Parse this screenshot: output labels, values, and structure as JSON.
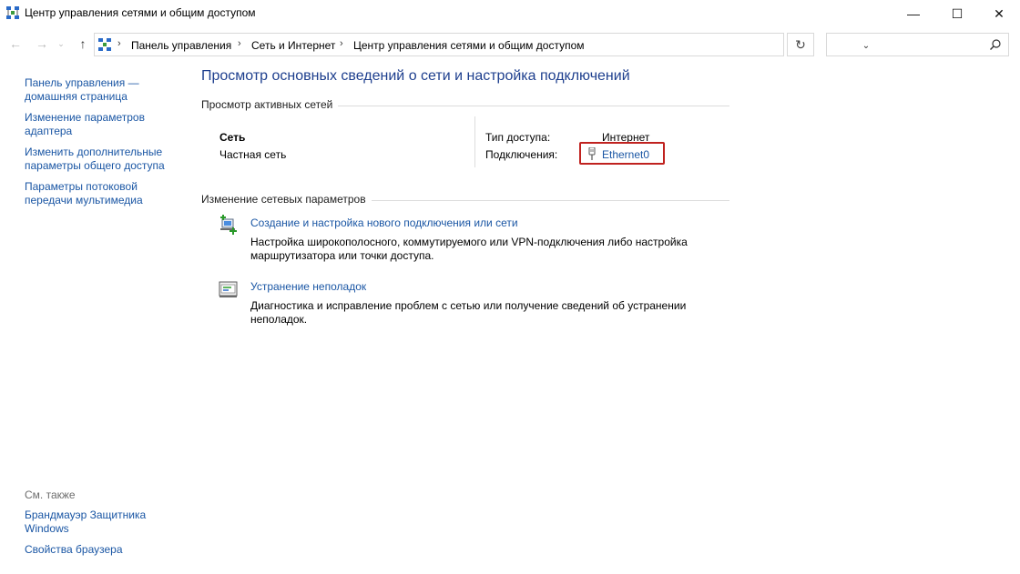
{
  "window": {
    "title": "Центр управления сетями и общим доступом",
    "minimize_glyph": "—",
    "maximize_glyph": "☐",
    "close_glyph": "✕"
  },
  "nav": {
    "back_glyph": "←",
    "forward_glyph": "→",
    "recent_glyph": "⌄",
    "up_glyph": "↑",
    "refresh_glyph": "↻",
    "dropdown_glyph": "⌄"
  },
  "breadcrumb": {
    "items": [
      "Панель управления",
      "Сеть и Интернет",
      "Центр управления сетями и общим доступом"
    ],
    "separator": "›"
  },
  "search": {
    "value": "",
    "placeholder": ""
  },
  "sidebar": {
    "links": [
      [
        "Панель управления —",
        "домашняя страница"
      ],
      [
        "Изменение параметров",
        "адаптера"
      ],
      [
        "Изменить дополнительные",
        "параметры общего доступа"
      ],
      [
        "Параметры потоковой",
        "передачи мультимедиа"
      ]
    ],
    "see_also_label": "См. также",
    "see_also_links": [
      [
        "Брандмауэр Защитника",
        "Windows"
      ],
      [
        "Свойства браузера"
      ]
    ]
  },
  "main": {
    "title": "Просмотр основных сведений о сети и настройка подключений",
    "active_networks_heading": "Просмотр активных сетей",
    "network": {
      "name": "Сеть",
      "category": "Частная сеть",
      "access_type_label": "Тип доступа:",
      "access_type_value": "Интернет",
      "connections_label": "Подключения:",
      "connection_name": "Ethernet0"
    },
    "change_settings_heading": "Изменение сетевых параметров",
    "tasks": [
      {
        "link": "Создание и настройка нового подключения или сети",
        "description": [
          "Настройка широкополосного, коммутируемого или VPN-подключения либо настройка",
          "маршрутизатора или точки доступа."
        ],
        "icon": "new-connection-icon"
      },
      {
        "link": "Устранение неполадок",
        "description": [
          "Диагностика и исправление проблем с сетью или получение сведений об устранении",
          "неполадок."
        ],
        "icon": "troubleshoot-icon"
      }
    ]
  },
  "colors": {
    "link": "#1a56a4",
    "title": "#1e3f8e",
    "highlight_border": "#c0221f",
    "divider": "#dcdcdc"
  }
}
